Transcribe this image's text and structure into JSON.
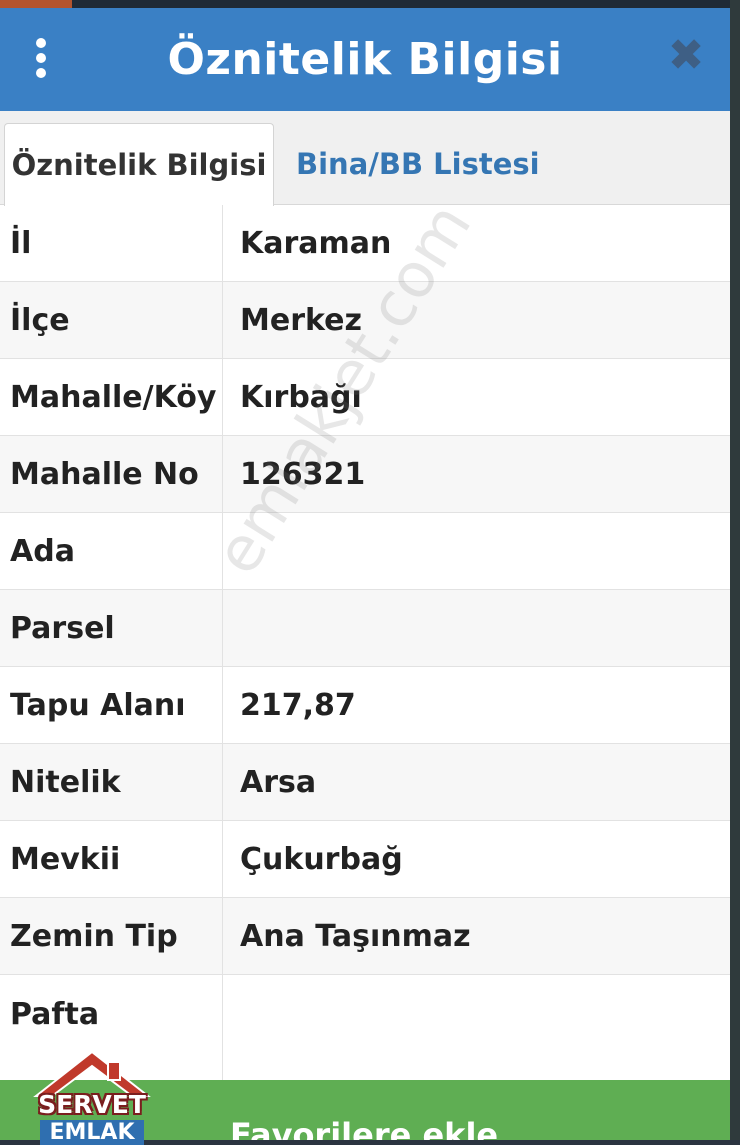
{
  "header": {
    "title": "Öznitelik Bilgisi",
    "menu_icon": "vertical-dots-icon",
    "close_icon": "close-icon",
    "close_glyph": "✖"
  },
  "tabs": [
    {
      "label": "Öznitelik Bilgisi",
      "active": true
    },
    {
      "label": "Bina/BB Listesi",
      "active": false
    }
  ],
  "attributes": [
    {
      "label": "İl",
      "value": "Karaman"
    },
    {
      "label": "İlçe",
      "value": "Merkez"
    },
    {
      "label": "Mahalle/Köy",
      "value": "Kırbağı"
    },
    {
      "label": "Mahalle No",
      "value": "126321"
    },
    {
      "label": "Ada",
      "value": ""
    },
    {
      "label": "Parsel",
      "value": ""
    },
    {
      "label": "Tapu Alanı",
      "value": "217,87"
    },
    {
      "label": "Nitelik",
      "value": "Arsa"
    },
    {
      "label": "Mevkii",
      "value": "Çukurbağ"
    },
    {
      "label": "Zemin Tip",
      "value": "Ana Taşınmaz"
    },
    {
      "label": "Pafta",
      "value": ""
    }
  ],
  "footer": {
    "button_label": "Favorilere ekle"
  },
  "watermark": "emlakjet.com",
  "logo": {
    "line1": "SERVET",
    "line2": "EMLAK"
  },
  "colors": {
    "header_bg": "#3a80c5",
    "tab_inactive_text": "#3576b3",
    "footer_bg": "#5fae53"
  }
}
